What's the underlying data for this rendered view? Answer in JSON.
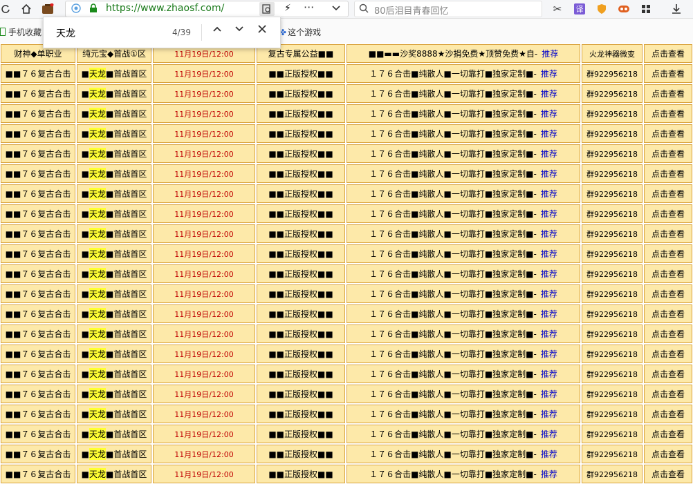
{
  "browser": {
    "url": "https://www.zhaosf.com/",
    "search_placeholder": "80后泪目青春回忆",
    "extension_translate": "译"
  },
  "bookmarks": [
    {
      "label": "手机收藏"
    },
    {
      "label": "这个游戏"
    }
  ],
  "find_bar": {
    "query": "天龙",
    "count": "4/39"
  },
  "table": {
    "header": {
      "c1": "财神◆单职业",
      "c2": "纯元宝◆首战①区",
      "c3": "11月19日/12:00",
      "c4": "复古专属公益■■",
      "c5": "■■▬▬沙奖8888★沙捐免费★顶赞免费★自-",
      "c5_rec": "推荐",
      "c6": "火龙神器微变",
      "c7": "点击查看"
    },
    "row": {
      "c1": "■■７６复古合击",
      "c2_pre": "■",
      "c2_hl": "天龙",
      "c2_post": "■首战首区",
      "c3": "11月19日/12:00",
      "c4": "■■正版授权■■",
      "c5": "１７６合击■纯散人■一切靠打■独家定制■-",
      "c5_rec": "推荐",
      "c6": "群922956218",
      "c7": "点击查看"
    }
  }
}
